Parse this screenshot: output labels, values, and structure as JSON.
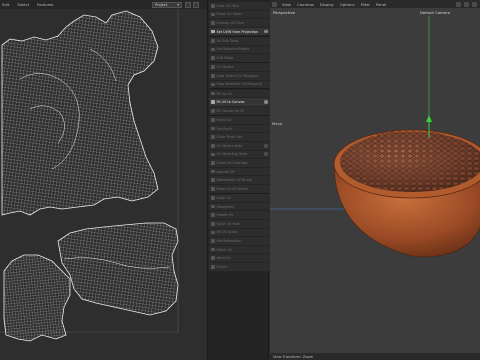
{
  "uv_editor": {
    "menu": [
      "Edit",
      "Select",
      "Features"
    ],
    "mode_dropdown": "Project"
  },
  "command_palette": {
    "items": [
      {
        "label": "Auto UV Pack",
        "state": "dim"
      },
      {
        "label": "Relax UV Mesh",
        "state": "dim"
      },
      {
        "label": "Unwrap UV Face",
        "state": "dim"
      },
      {
        "label": "Set UVW from Projection",
        "state": "active",
        "gear": true
      },
      {
        "label": "UV Edit Tools",
        "state": "dim"
      },
      {
        "label": "Set Selected Edges",
        "state": "dim"
      },
      {
        "label": "Edit Mode",
        "state": "dim"
      },
      {
        "label": "UV Modes",
        "state": "dim"
      },
      {
        "label": "Auto Select UV Polygons",
        "state": "dim"
      },
      {
        "label": "Stop Realtime UV Mapping",
        "state": "dim"
      },
      {
        "label": "Pin to UV",
        "state": "dim"
      },
      {
        "label": "Fit UV to Canvas",
        "state": "active",
        "gear": true
      },
      {
        "label": "Fit Canvas to UV",
        "state": "dim"
      },
      {
        "label": "Relax UV",
        "state": "dim"
      },
      {
        "label": "Set Pinch",
        "state": "dim"
      },
      {
        "label": "Clear Pinch Set",
        "state": "dim"
      },
      {
        "label": "UV Modes Auto",
        "state": "dim",
        "gear": true
      },
      {
        "label": "UV Modeling Tools",
        "state": "dim",
        "gear": true
      },
      {
        "label": "Show UV Overlaps",
        "state": "dim"
      },
      {
        "label": "Islands Off",
        "state": "dim"
      },
      {
        "label": "Remember UV Brush",
        "state": "dim"
      },
      {
        "label": "Reset to UV Island",
        "state": "dim"
      },
      {
        "label": "Align UV",
        "state": "dim"
      },
      {
        "label": "Straighten",
        "state": "dim"
      },
      {
        "label": "Rotate UV",
        "state": "dim"
      },
      {
        "label": "Scale UV Feat",
        "state": "dim"
      },
      {
        "label": "Fill UV Scale",
        "state": "dim"
      },
      {
        "label": "Set Relaxation",
        "state": "dim"
      },
      {
        "label": "Stitch UV",
        "state": "dim"
      },
      {
        "label": "Weld UV",
        "state": "dim"
      },
      {
        "label": "Shrink",
        "state": "dim"
      }
    ]
  },
  "viewport": {
    "menu": [
      "View",
      "Cameras",
      "Display",
      "Options",
      "Filter",
      "Panel"
    ],
    "projection_label": "Perspective",
    "camera_label": "Default Camera",
    "camera_icon": "camera-icon",
    "tool_label": "Move",
    "status_text": "View Transform: Zoom"
  },
  "colors": {
    "uv_wire": "#e6e6e6",
    "uv_background": "#2e2e2e",
    "viewport_background": "#3c3c3c",
    "axis_y": "#3ad13a",
    "axis_x": "#4a7fd6",
    "bowl": "#a9532a",
    "beans": "#6b3a26"
  }
}
